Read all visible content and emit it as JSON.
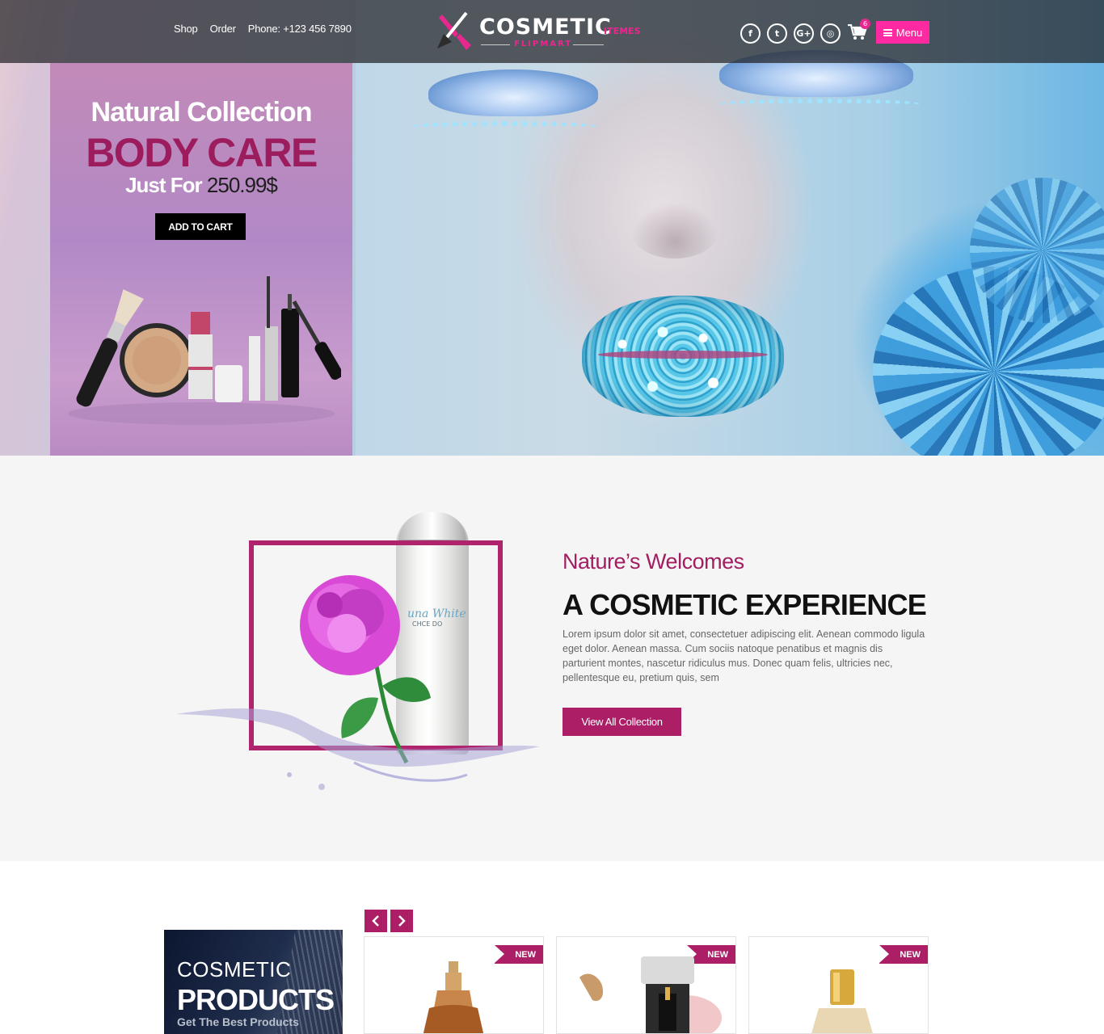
{
  "header": {
    "nav": [
      "Shop",
      "Order",
      "Phone: +123 456 7890"
    ],
    "logo": {
      "main": "COSMETIC",
      "tag": "ITEMES",
      "sub": "FLIPMART"
    },
    "socials": [
      {
        "name": "facebook-icon",
        "glyph": "f"
      },
      {
        "name": "twitter-icon",
        "glyph": "t"
      },
      {
        "name": "google-plus-icon",
        "glyph": "G+"
      },
      {
        "name": "instagram-icon",
        "glyph": "◎"
      }
    ],
    "cart_count": "6",
    "menu_label": "Menu"
  },
  "hero": {
    "line1": "Natural Collection",
    "line2": "BODY CARE",
    "price_label": "Just For",
    "price": "250.99$",
    "cta": "ADD TO CART"
  },
  "welcome": {
    "kicker": "Nature’s Welcomes",
    "title": "A COSMETIC EXPERIENCE",
    "body": "Lorem ipsum dolor sit amet, consectetuer adipiscing elit. Aenean commodo ligula eget dolor. Aenean massa. Cum sociis natoque penatibus et magnis dis parturient montes, nascetur ridiculus mus. Donec quam felis, ultricies nec, pellentesque eu, pretium quis, sem",
    "button": "View All Collection",
    "bottle_brand": "una White",
    "bottle_sub": "CHCE DO"
  },
  "products": {
    "promo_line1": "COSMETIC",
    "promo_line2": "PRODUCTS",
    "promo_line3": "Get The Best Products",
    "cards": [
      {
        "badge": "NEW"
      },
      {
        "badge": "NEW"
      },
      {
        "badge": "NEW"
      }
    ]
  },
  "colors": {
    "accent": "#ac1f67",
    "menu": "#ff2aa1",
    "brand_pink": "#e8288f"
  }
}
